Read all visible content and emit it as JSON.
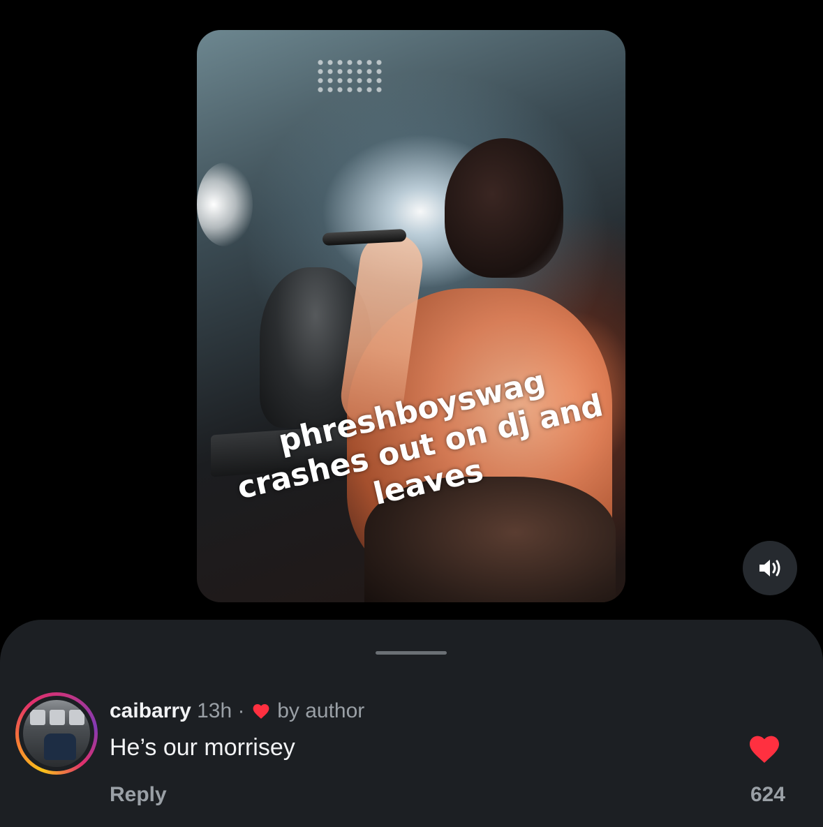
{
  "video": {
    "caption_lines": [
      "phreshboyswag",
      "crashes out on dj and",
      "leaves"
    ]
  },
  "volume_icon": "speaker-volume-icon",
  "comment": {
    "username": "caibarry",
    "time": "13h",
    "separator": "·",
    "liked_by_author_label": "by author",
    "text": "He’s our morrisey",
    "reply_label": "Reply",
    "like_count": "624",
    "like_icon": "heart-icon",
    "colors": {
      "heart": "#ff3040",
      "meta": "#9aa0a6"
    }
  }
}
